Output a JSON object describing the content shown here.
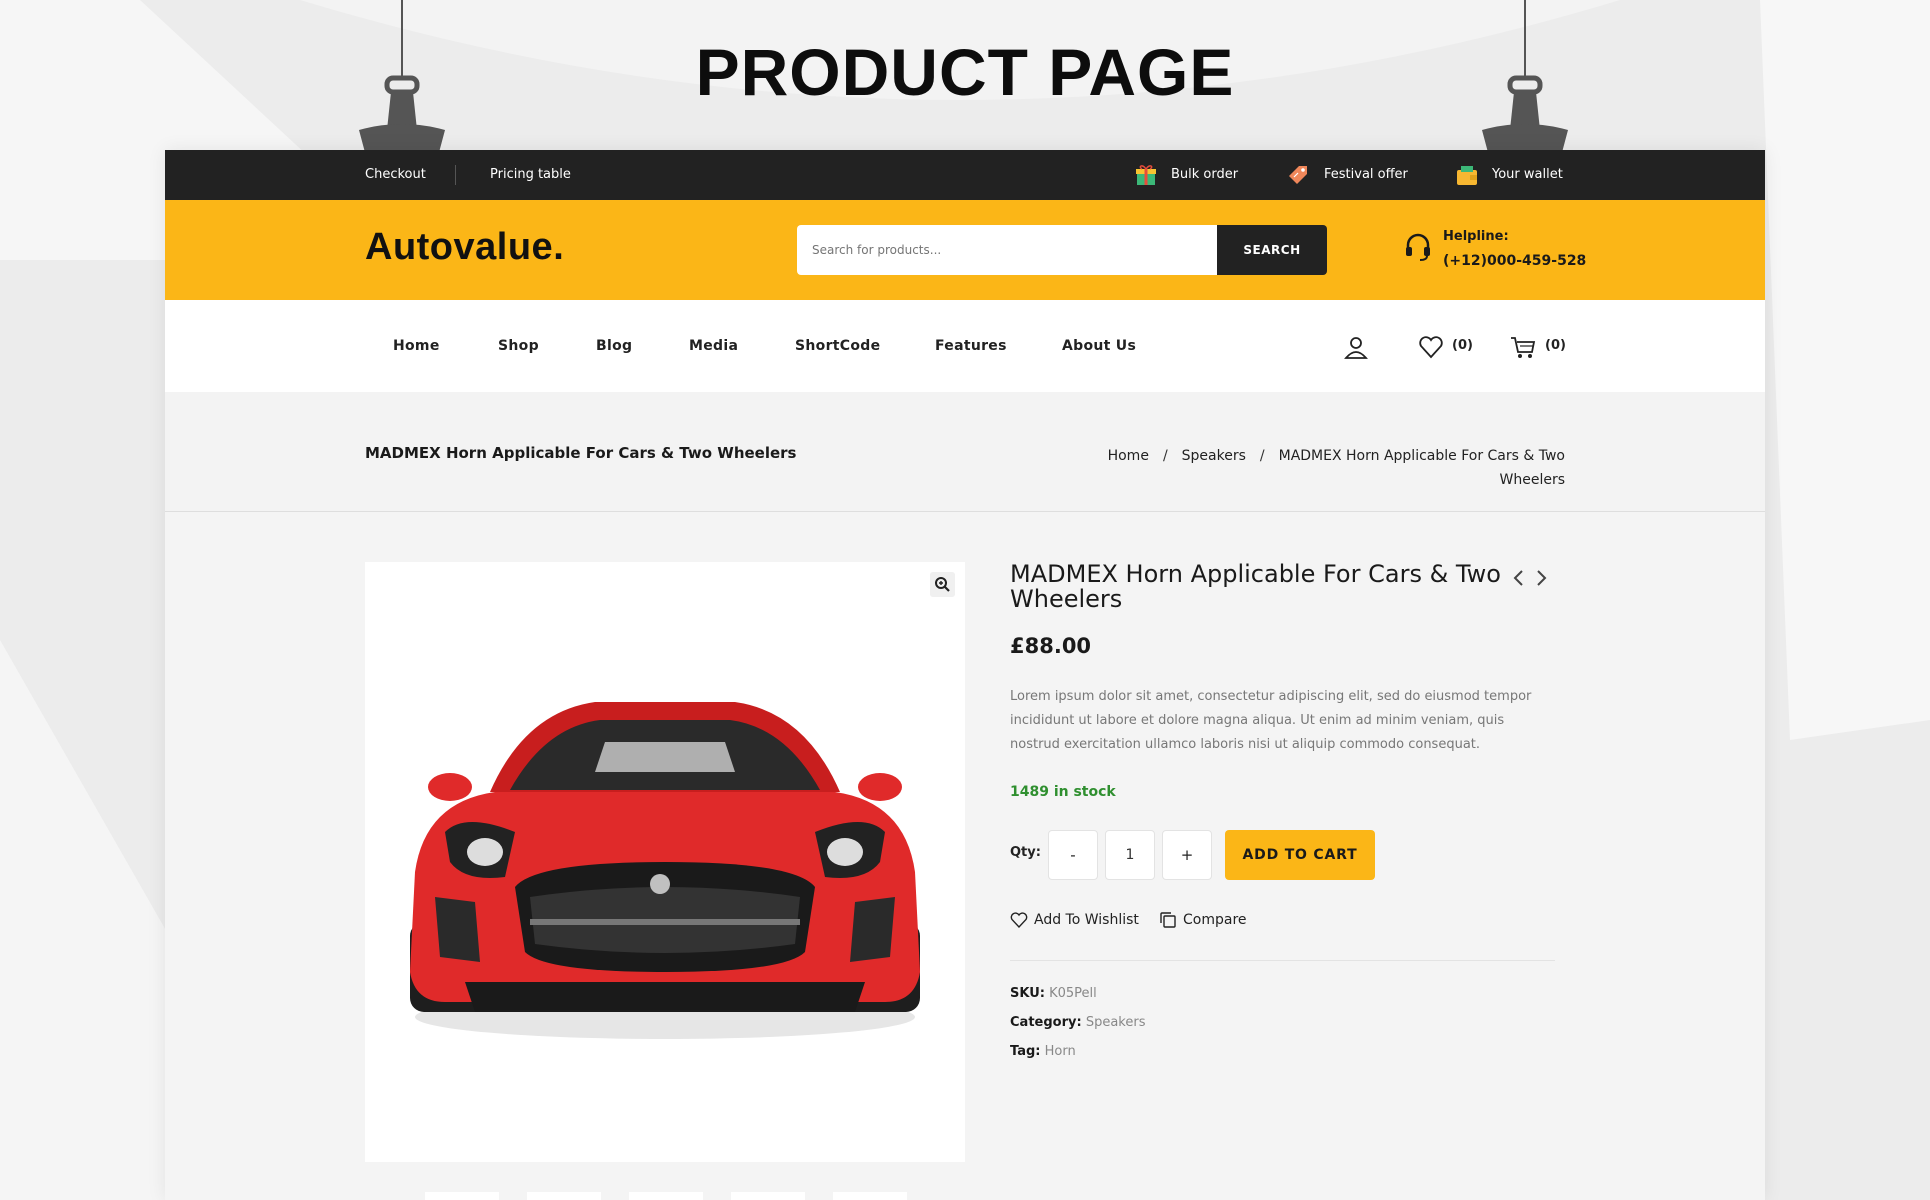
{
  "heading": "PRODUCT PAGE",
  "topbar": {
    "links": [
      "Checkout",
      "Pricing table"
    ],
    "promos": [
      {
        "label": "Bulk order",
        "icon": "gift-icon"
      },
      {
        "label": "Festival offer",
        "icon": "tag-icon"
      },
      {
        "label": "Your wallet",
        "icon": "wallet-icon"
      }
    ]
  },
  "header": {
    "logo": "Autovalue.",
    "search": {
      "placeholder": "Search for products...",
      "button": "SEARCH"
    },
    "helpline": {
      "label": "Helpline:",
      "phone": "(+12)000-459-528",
      "icon": "headset-icon"
    }
  },
  "nav": {
    "items": [
      "Home",
      "Shop",
      "Blog",
      "Media",
      "ShortCode",
      "Features",
      "About Us"
    ],
    "wishlist_count": "(0)",
    "cart_count": "(0)"
  },
  "breadcrumb": {
    "title": "MADMEX Horn Applicable For Cars & Two Wheelers",
    "home": "Home",
    "category": "Speakers",
    "current": "MADMEX Horn Applicable For Cars & Two Wheelers"
  },
  "product": {
    "title": "MADMEX Horn Applicable For Cars & Two Wheelers",
    "price": "£88.00",
    "description": "Lorem ipsum dolor sit amet, consectetur adipiscing elit, sed do eiusmod tempor incididunt ut labore et dolore magna aliqua. Ut enim ad minim veniam, quis nostrud exercitation ullamco laboris nisi ut aliquip commodo consequat.",
    "stock": "1489 in stock",
    "qty_label": "Qty:",
    "qty_minus": "-",
    "qty_value": "1",
    "qty_plus": "+",
    "add_to_cart": "ADD TO CART",
    "wishlist": "Add To Wishlist",
    "compare": "Compare",
    "sku_label": "SKU:",
    "sku": "K05Pell",
    "category_label": "Category:",
    "category": "Speakers",
    "tag_label": "Tag:",
    "tag": "Horn"
  },
  "colors": {
    "accent": "#fbb617",
    "dark": "#222222",
    "stock": "#2f8f2f"
  }
}
